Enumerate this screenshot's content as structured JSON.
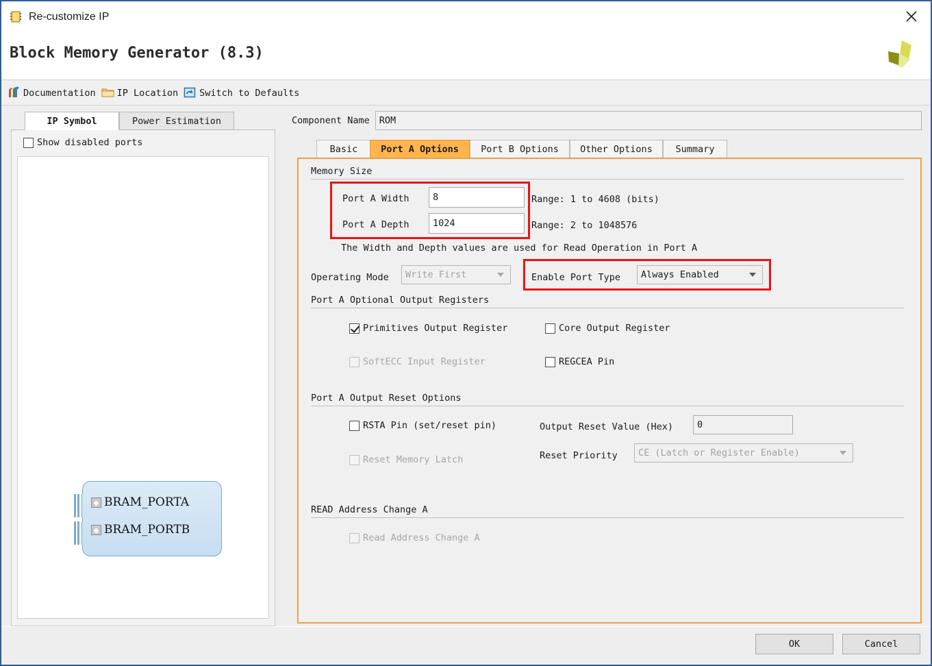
{
  "window": {
    "title": "Re-customize IP",
    "title_icon": "ip-core-icon",
    "close_icon": "close-icon"
  },
  "header": {
    "app_title": "Block Memory Generator (8.3)",
    "logo": "xilinx-logo"
  },
  "toolbar": {
    "items": [
      {
        "label": "Documentation",
        "icon": "books-icon"
      },
      {
        "label": "IP Location",
        "icon": "folder-icon"
      },
      {
        "label": "Switch to Defaults",
        "icon": "refresh-icon"
      }
    ]
  },
  "left_panel": {
    "tabs": [
      {
        "label": "IP Symbol",
        "active": true
      },
      {
        "label": "Power Estimation",
        "active": false
      }
    ],
    "show_disabled_ports": {
      "label": "Show disabled ports",
      "checked": false
    },
    "symbol": {
      "ports": [
        "BRAM_PORTA",
        "BRAM_PORTB"
      ]
    }
  },
  "right_panel": {
    "component_name": {
      "label": "Component Name",
      "value": "ROM"
    },
    "tabs": [
      {
        "label": "Basic",
        "active": false
      },
      {
        "label": "Port A Options",
        "active": true
      },
      {
        "label": "Port B Options",
        "active": false
      },
      {
        "label": "Other Options",
        "active": false
      },
      {
        "label": "Summary",
        "active": false
      }
    ],
    "memory_size": {
      "heading": "Memory Size",
      "port_a_width": {
        "label": "Port A Width",
        "value": "8",
        "range": "Range: 1 to 4608 (bits)"
      },
      "port_a_depth": {
        "label": "Port A Depth",
        "value": "1024",
        "range": "Range: 2 to 1048576"
      },
      "note": "The Width and Depth values are used for Read Operation in Port A"
    },
    "operating_mode": {
      "label": "Operating Mode",
      "value": "Write First",
      "disabled": true
    },
    "enable_port_type": {
      "label": "Enable Port Type",
      "value": "Always Enabled",
      "disabled": false
    },
    "optional_output_registers": {
      "heading": "Port A Optional Output Registers",
      "items": [
        {
          "label": "Primitives Output Register",
          "checked": true,
          "disabled": false
        },
        {
          "label": "Core Output Register",
          "checked": false,
          "disabled": false
        },
        {
          "label": "SoftECC Input Register",
          "checked": false,
          "disabled": true
        },
        {
          "label": "REGCEA Pin",
          "checked": false,
          "disabled": false
        }
      ]
    },
    "output_reset_options": {
      "heading": "Port A Output Reset Options",
      "rsta_pin": {
        "label": "RSTA Pin (set/reset pin)",
        "checked": false,
        "disabled": false
      },
      "reset_memory_latch": {
        "label": "Reset Memory Latch",
        "checked": false,
        "disabled": true
      },
      "output_reset_value": {
        "label": "Output Reset Value (Hex)",
        "value": "0"
      },
      "reset_priority": {
        "label": "Reset Priority",
        "value": "CE (Latch or Register Enable)",
        "disabled": true
      }
    },
    "read_address_change": {
      "heading": "READ Address Change A",
      "checkbox": {
        "label": "Read Address Change A",
        "checked": false,
        "disabled": true
      }
    }
  },
  "footer": {
    "ok_label": "OK",
    "cancel_label": "Cancel"
  },
  "colors": {
    "accent_orange": "#f0a03c",
    "highlight_red": "#ee1111",
    "window_border": "#2a6099",
    "active_tab": "#ffb44d"
  }
}
